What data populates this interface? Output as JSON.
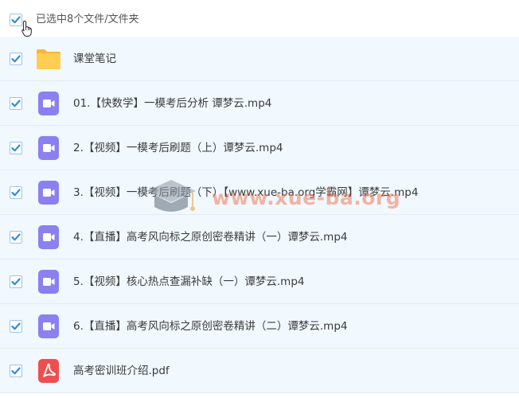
{
  "selection": {
    "label": "已选中8个文件/文件夹",
    "checked": true
  },
  "files": [
    {
      "name": "课堂笔记",
      "type": "folder",
      "icon": "folder-icon",
      "checked": true
    },
    {
      "name": "01.【快数学】一模考后分析 谭梦云.mp4",
      "type": "video",
      "icon": "video-file-icon",
      "checked": true
    },
    {
      "name": "2.【视频】一模考后刷题（上）谭梦云.mp4",
      "type": "video",
      "icon": "video-file-icon",
      "checked": true
    },
    {
      "name": "3.【视频】一模考后刷题（下）【www.xue-ba.org学霸网】谭梦云.mp4",
      "type": "video",
      "icon": "video-file-icon",
      "checked": true
    },
    {
      "name": "4.【直播】高考风向标之原创密卷精讲（一）谭梦云.mp4",
      "type": "video",
      "icon": "video-file-icon",
      "checked": true
    },
    {
      "name": "5.【视频】核心热点查漏补缺（一）谭梦云.mp4",
      "type": "video",
      "icon": "video-file-icon",
      "checked": true
    },
    {
      "name": "6.【直播】高考风向标之原创密卷精讲（二）谭梦云.mp4",
      "type": "video",
      "icon": "video-file-icon",
      "checked": true
    },
    {
      "name": "高考密训班介绍.pdf",
      "type": "pdf",
      "icon": "pdf-file-icon",
      "checked": true
    }
  ],
  "watermark": {
    "text": "www.xue-ba.org"
  },
  "colors": {
    "check": "#2a8be6",
    "video": "#8c7ff0",
    "folder": "#ffc94c",
    "pdf": "#ee4e4e",
    "row_bg": "#f1f8fe"
  }
}
